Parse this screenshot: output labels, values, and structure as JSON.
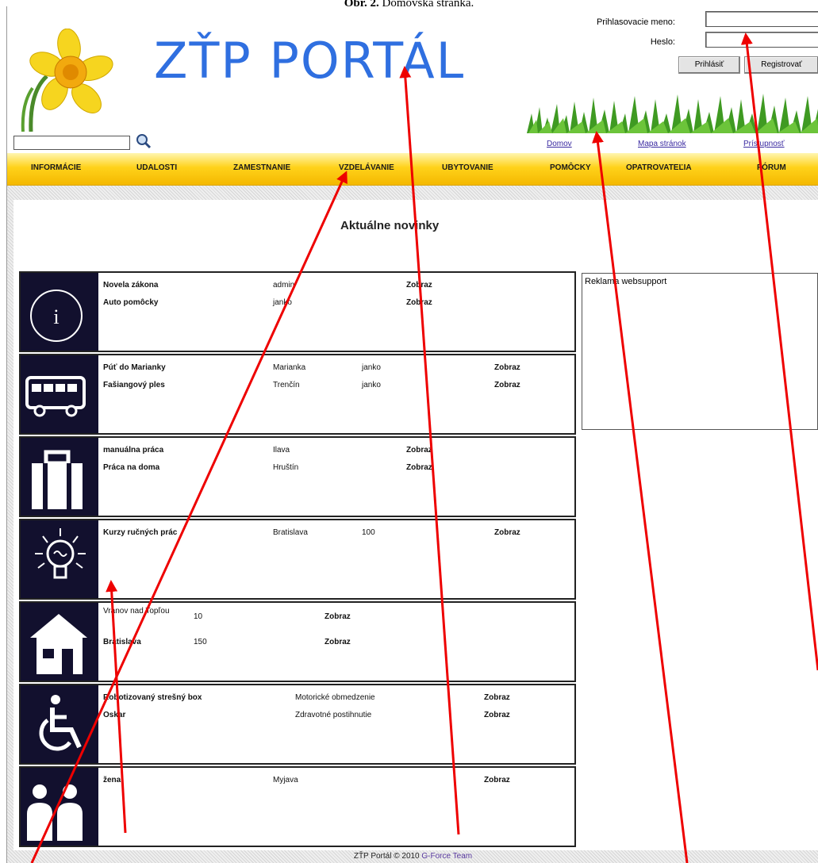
{
  "caption": {
    "label": "Obr. 2.",
    "text": "Domovská stránka."
  },
  "header": {
    "logo_text": "ZŤP PORTÁL",
    "login_label": "Prihlasovacie meno:",
    "password_label": "Heslo:",
    "login_button": "Prihlásiť",
    "register_button": "Registrovať",
    "links": [
      "Domov",
      "Mapa stránok",
      "Prístupnosť"
    ]
  },
  "nav": [
    "INFORMÁCIE",
    "UDALOSTI",
    "ZAMESTNANIE",
    "VZDELÁVANIE",
    "UBYTOVANIE",
    "POMÔCKY",
    "OPATROVATEĽIA",
    "FÓRUM"
  ],
  "main": {
    "title": "Aktuálne novinky",
    "sections": [
      {
        "icon": "info-icon",
        "rows": [
          [
            "Novela zákona",
            "admin",
            "Zobraz"
          ],
          [
            "Auto pomôcky",
            "janko",
            "Zobraz"
          ]
        ]
      },
      {
        "icon": "bus-icon",
        "rows": [
          [
            "Púť do Marianky",
            "Marianka",
            "janko",
            "Zobraz"
          ],
          [
            "Fašiangový ples",
            "Trenčín",
            "janko",
            "Zobraz"
          ]
        ]
      },
      {
        "icon": "briefcase-icon",
        "rows": [
          [
            "manuálna práca",
            "Ilava",
            "Zobraz"
          ],
          [
            "Práca na doma",
            "Hruštín",
            "Zobraz"
          ]
        ]
      },
      {
        "icon": "lightbulb-icon",
        "rows": [
          [
            "Kurzy ručných prác",
            "Bratislava",
            "100",
            "Zobraz"
          ]
        ]
      },
      {
        "icon": "house-icon",
        "rows": [
          [
            "Vranov nad Topľou",
            "10",
            "Zobraz"
          ],
          [
            "Bratislava",
            "150",
            "Zobraz"
          ]
        ]
      },
      {
        "icon": "wheelchair-icon",
        "rows": [
          [
            "Robotizovaný strešný box",
            "Motorické obmedzenie",
            "Zobraz"
          ],
          [
            "Oskar",
            "Zdravotné postihnutie",
            "Zobraz"
          ]
        ]
      },
      {
        "icon": "people-icon",
        "rows": [
          [
            "žena",
            "Myjava",
            "Zobraz"
          ]
        ]
      }
    ]
  },
  "ad": {
    "text": "Reklama websupport"
  },
  "footer": {
    "text": "ZŤP Portál © 2010",
    "team": "G-Force Team"
  },
  "colors": {
    "nav_yellow": "#ffd21a",
    "icon_bg": "#12102e",
    "logo_blue": "#2f6fe0",
    "arrow_red": "#ee0000"
  }
}
